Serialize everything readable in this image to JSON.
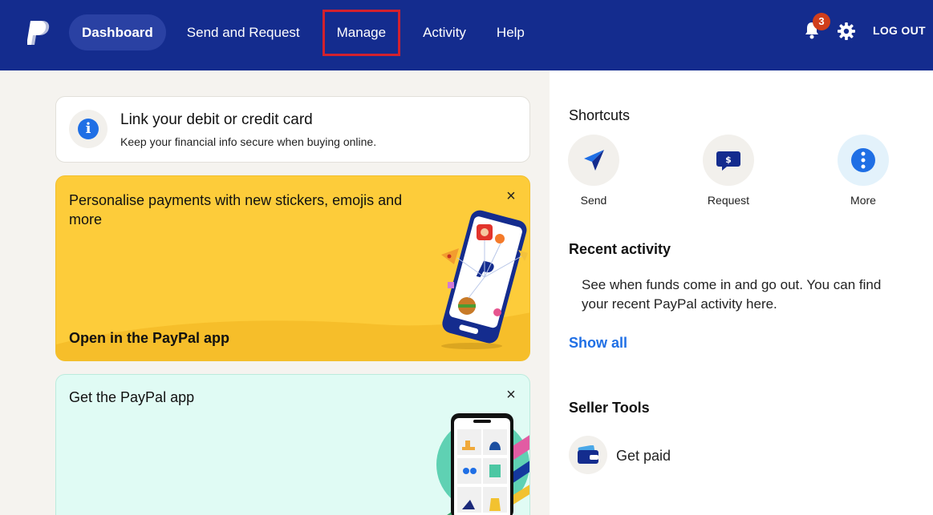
{
  "nav": {
    "items": [
      {
        "label": "Dashboard"
      },
      {
        "label": "Send and Request"
      },
      {
        "label": "Manage"
      },
      {
        "label": "Activity"
      },
      {
        "label": "Help"
      }
    ],
    "notification_count": "3",
    "logout_label": "LOG OUT"
  },
  "link_card": {
    "title": "Link your debit or credit card",
    "subtitle": "Keep your financial info secure when buying online."
  },
  "promo_card": {
    "text": "Personalise payments with new stickers, emojis and more",
    "cta": "Open in the PayPal app"
  },
  "app_card": {
    "title": "Get the PayPal app"
  },
  "shortcuts": {
    "title": "Shortcuts",
    "items": [
      {
        "label": "Send"
      },
      {
        "label": "Request"
      },
      {
        "label": "More"
      }
    ]
  },
  "recent_activity": {
    "title": "Recent activity",
    "text": "See when funds come in and go out. You can find your recent PayPal activity here.",
    "show_all": "Show all"
  },
  "seller_tools": {
    "title": "Seller Tools",
    "get_paid": "Get paid"
  },
  "colors": {
    "header": "#142c8e",
    "accent": "#1f6fe5",
    "promo_bg": "#fdcc3a",
    "mint_bg": "#e0fbf4",
    "badge": "#d03e1c"
  }
}
